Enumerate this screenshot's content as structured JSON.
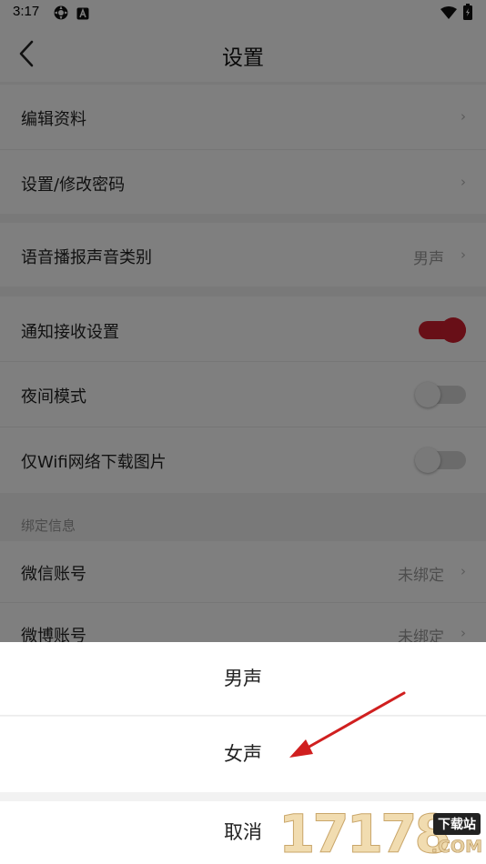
{
  "status_bar": {
    "time": "3:17"
  },
  "header": {
    "title": "设置"
  },
  "rows": {
    "edit_profile": {
      "label": "编辑资料"
    },
    "change_password": {
      "label": "设置/修改密码"
    },
    "voice_type": {
      "label": "语音播报声音类别",
      "value": "男声"
    },
    "notifications": {
      "label": "通知接收设置",
      "on": true
    },
    "night_mode": {
      "label": "夜间模式",
      "on": false
    },
    "wifi_images": {
      "label": "仅Wifi网络下载图片",
      "on": false
    }
  },
  "binding": {
    "section_title": "绑定信息",
    "wechat": {
      "label": "微信账号",
      "value": "未绑定"
    },
    "weibo": {
      "label": "微博账号",
      "value": "未绑定"
    }
  },
  "sheet": {
    "options": [
      "男声",
      "女声"
    ],
    "cancel": "取消"
  },
  "watermark": {
    "number": "17178",
    "site": "下载站",
    "suffix": ".COM"
  },
  "colors": {
    "accent": "#d11e2e",
    "toggle_off": "#cfcfcf"
  },
  "icons": [
    "settings-gear-icon",
    "a-badge-icon",
    "wifi-icon",
    "battery-icon",
    "back-arrow-icon",
    "chevron-right-icon"
  ]
}
